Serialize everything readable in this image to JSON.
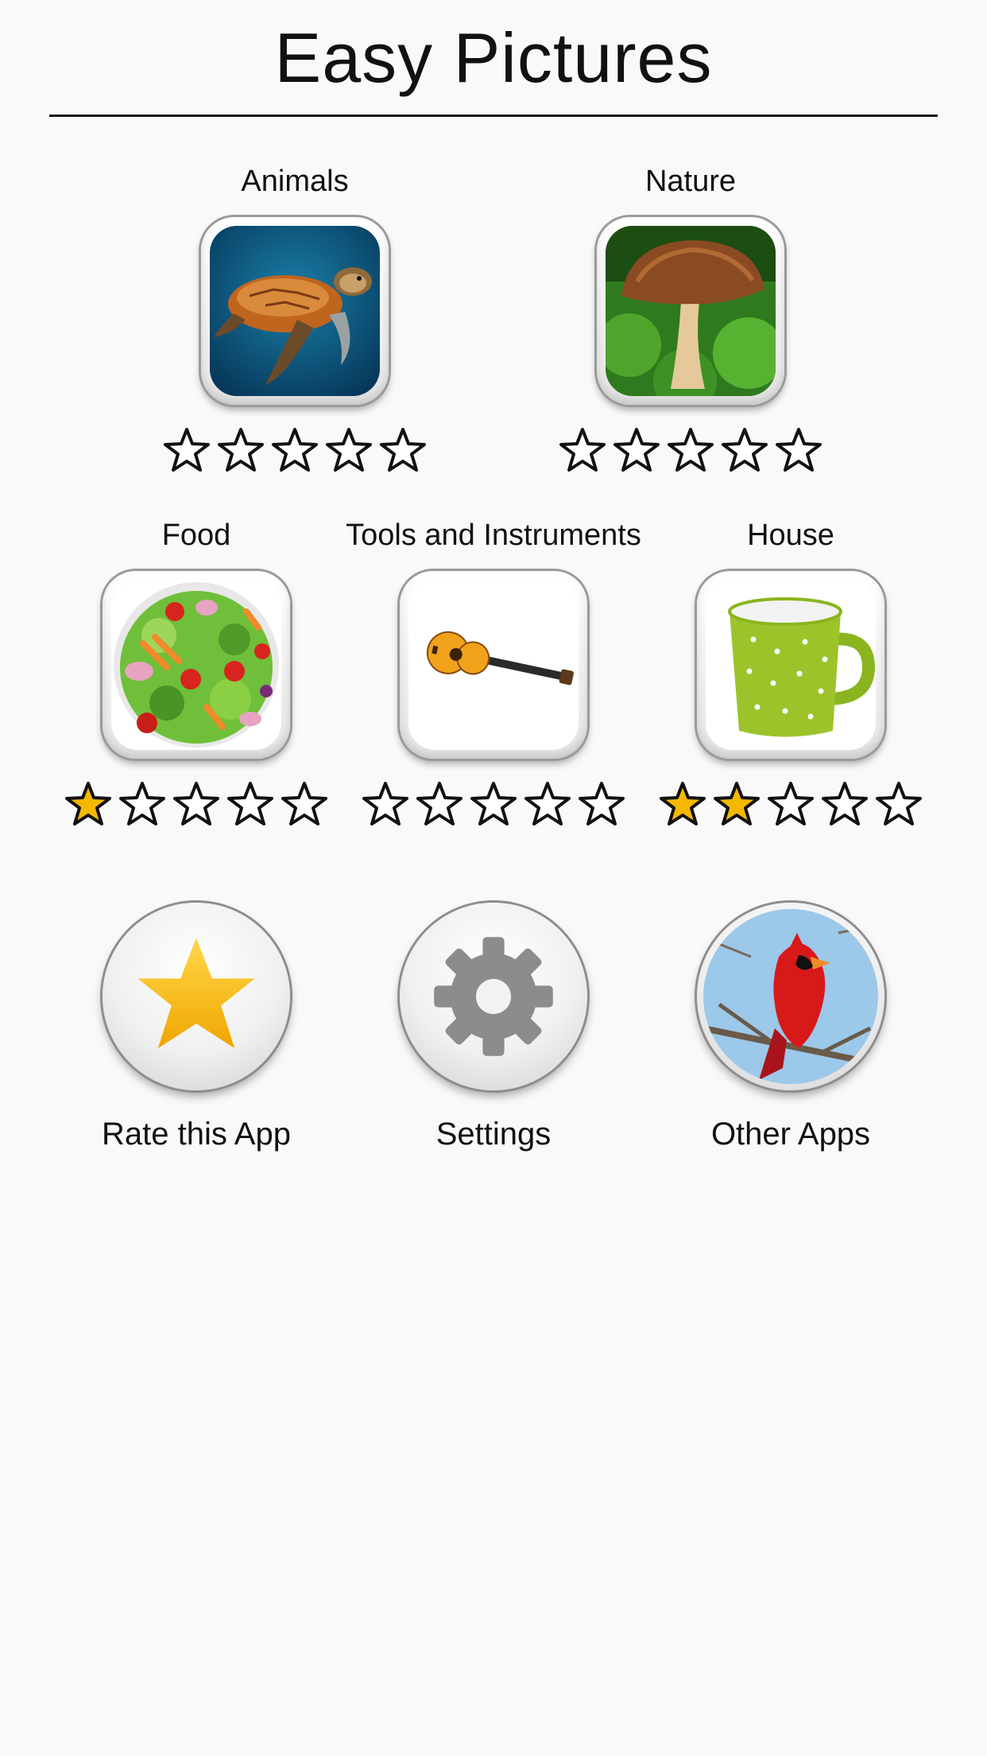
{
  "header": {
    "title": "Easy Pictures"
  },
  "categories": [
    {
      "label": "Animals",
      "image": "sea-turtle",
      "stars": 0,
      "max_stars": 5
    },
    {
      "label": "Nature",
      "image": "mushroom",
      "stars": 0,
      "max_stars": 5
    },
    {
      "label": "Food",
      "image": "salad-bowl",
      "stars": 1,
      "max_stars": 5
    },
    {
      "label": "Tools and Instruments",
      "image": "acoustic-guitar",
      "stars": 0,
      "max_stars": 5
    },
    {
      "label": "House",
      "image": "green-polka-dot-mug",
      "stars": 2,
      "max_stars": 5
    }
  ],
  "actions": [
    {
      "label": "Rate this App",
      "icon": "star-icon"
    },
    {
      "label": "Settings",
      "icon": "gear-icon"
    },
    {
      "label": "Other Apps",
      "icon": "cardinal-bird"
    }
  ],
  "colors": {
    "star_filled": "#f5b800",
    "star_outline": "#111111",
    "background": "#f9f9f9"
  }
}
